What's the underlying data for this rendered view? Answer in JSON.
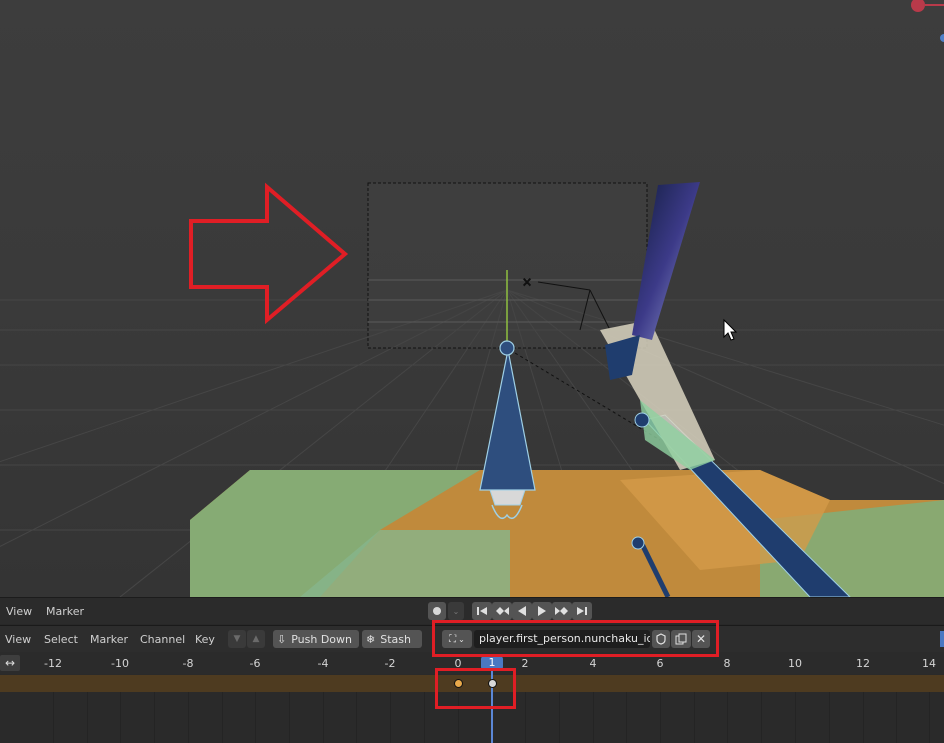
{
  "timeline_header": {
    "menus": [
      "View",
      "Marker"
    ],
    "playback": [
      "jump-start-icon",
      "prev-keyframe-icon",
      "play-reverse-icon",
      "play-icon",
      "next-keyframe-icon",
      "jump-end-icon"
    ]
  },
  "dopesheet_header": {
    "menus": [
      "View",
      "Select",
      "Marker",
      "Channel",
      "Key"
    ],
    "push_down_label": "Push Down",
    "stash_label": "Stash",
    "action_name": "player.first_person.nunchaku_idle"
  },
  "ruler": {
    "labels": [
      "-12",
      "-10",
      "-8",
      "-6",
      "-4",
      "-2",
      "0",
      "2",
      "4",
      "6",
      "8",
      "10",
      "12",
      "14"
    ],
    "current_frame": "1"
  },
  "keyframes": [
    0,
    1
  ],
  "colors": {
    "annotation_red": "#e01e25",
    "playhead_blue": "#4a78c2",
    "keyframe_selected": "#e8a84a",
    "keyframe_normal": "#d8d8d8"
  }
}
